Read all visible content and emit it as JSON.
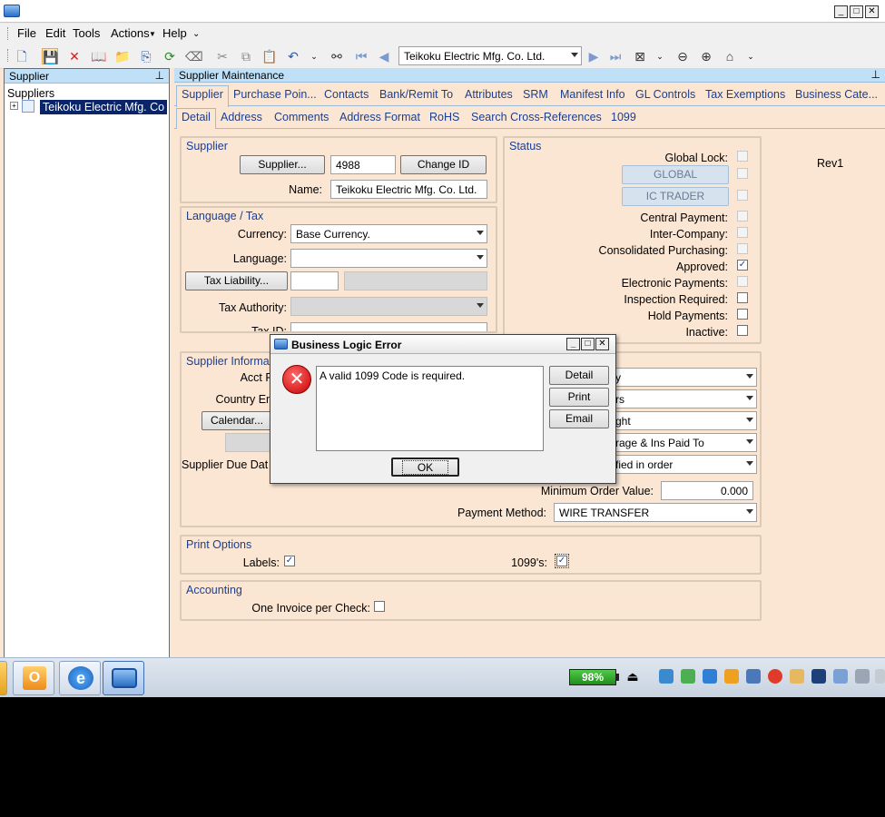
{
  "app": {
    "menu": [
      "File",
      "Edit",
      "Tools",
      "Actions",
      "Help"
    ],
    "toolbar_combo": "Teikoku Electric Mfg. Co. Ltd."
  },
  "left_pane": {
    "header": "Supplier",
    "tree_root": "Suppliers",
    "tree_item": "Teikoku Electric Mfg. Co"
  },
  "main": {
    "header": "Supplier Maintenance",
    "tabs": [
      "Supplier",
      "Purchase Poin...",
      "Contacts",
      "Bank/Remit To",
      "Attributes",
      "SRM",
      "Manifest Info",
      "GL Controls",
      "Tax Exemptions",
      "Business Cate..."
    ],
    "subtabs": [
      "Detail",
      "Address",
      "Comments",
      "Address Format",
      "RoHS",
      "Search Cross-References",
      "1099"
    ],
    "rev_label": "Rev1",
    "supplier_group": {
      "title": "Supplier",
      "supplier_button": "Supplier...",
      "supplier_id": "4988",
      "change_id_button": "Change ID",
      "name_label": "Name:",
      "name_value": "Teikoku Electric Mfg. Co. Ltd."
    },
    "lang_group": {
      "title": "Language / Tax",
      "currency_label": "Currency:",
      "currency_value": "Base Currency.",
      "language_label": "Language:",
      "language_value": "",
      "tax_liability_button": "Tax Liability...",
      "tax_authority_label": "Tax Authority:",
      "tax_id_label": "Tax ID:"
    },
    "status_group": {
      "title": "Status",
      "global_lock": "Global Lock:",
      "global_button": "GLOBAL",
      "ic_trader_button": "IC TRADER",
      "central_payment": "Central Payment:",
      "inter_company": "Inter-Company:",
      "consolidated": "Consolidated Purchasing:",
      "approved": "Approved:",
      "electronic": "Electronic Payments:",
      "inspection": "Inspection Required:",
      "hold": "Hold Payments:",
      "inactive": "Inactive:"
    },
    "info_group": {
      "title": "Supplier Informa",
      "acct_label": "Acct F",
      "country_label": "Country En",
      "calendar_button": "Calendar...",
      "due_date_label": "Supplier Due Dat",
      "combo1": "y",
      "combo2": "rs",
      "combo3": "ght",
      "combo4": "rage & Ins Paid To",
      "combo5": "fied in order",
      "min_order_label": "Minimum Order Value:",
      "min_order_value": "0.000",
      "payment_method_label": "Payment Method:",
      "payment_method_value": "WIRE TRANSFER"
    },
    "print_group": {
      "title": "Print Options",
      "labels_label": "Labels:",
      "form1099_label": "1099's:"
    },
    "accounting_group": {
      "title": "Accounting",
      "one_invoice_label": "One Invoice per Check:"
    }
  },
  "dialog": {
    "title": "Business Logic Error",
    "message": "A valid 1099 Code is required.",
    "detail_button": "Detail",
    "print_button": "Print",
    "email_button": "Email",
    "ok_button": "OK"
  },
  "taskbar": {
    "battery": "98%"
  },
  "checks": {
    "approved": true,
    "labels": true,
    "form1099": true,
    "one_invoice": false
  }
}
